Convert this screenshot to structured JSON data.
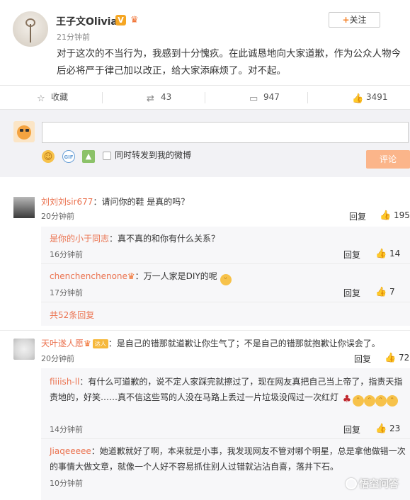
{
  "post": {
    "username": "王子文Olivia",
    "verified_badge": "V",
    "time": "21分钟前",
    "text": "对于这次的不当行为，我感到十分愧疚。在此诚恳地向大家道歉，作为公众人物今后必将严于律己加以改正，给大家添麻烦了。对不起。",
    "follow_label": "关注",
    "follow_plus": "+"
  },
  "actions": {
    "favorite": "收藏",
    "repost_count": "43",
    "comment_count": "947",
    "like_count": "3491"
  },
  "composer": {
    "input_value": "",
    "repost_label": "同时转发到我的微博",
    "submit_label": "评论",
    "gif_label": "GIF"
  },
  "comments": [
    {
      "name": "刘刘刘sir677",
      "text": "：请问你的鞋 是真的吗？",
      "time": "20分钟前",
      "reply": "回复",
      "likes": "195",
      "sub_replies": [
        {
          "name": "是你的小于同志",
          "text": "：真不真的和你有什么关系？",
          "time": "16分钟前",
          "reply": "回复",
          "likes": "14"
        },
        {
          "name": "chenchenchenone",
          "text": "：万一人家是DIY的呢",
          "time": "17分钟前",
          "reply": "回复",
          "likes": "7"
        }
      ],
      "more_replies": "共52条回复"
    },
    {
      "name": "天叶遂人愿",
      "badge": "达人",
      "text": "：是自己的错那就道歉让你生气了；不是自己的错那就抱歉让你误会了。",
      "time": "20分钟前",
      "reply": "回复",
      "likes": "72",
      "sub_replies": [
        {
          "name": "fiiiish-ll",
          "text": "：有什么可道歉的，说不定人家踩完就擦过了，现在网友真把自己当上帝了，指责天指责地的，好笑……真不信这些骂的人没在马路上丢过一片垃圾没闯过一次红灯",
          "time": "14分钟前",
          "reply": "回复",
          "likes": "23"
        },
        {
          "name": "Jiaqeeeee",
          "text": "：她道歉就好了啊，本来就是小事，我发现网友不管对哪个明星，总是拿他做错一次的事情大做文章，就像一个人好不容易抓住别人过错就沾沾自喜，落井下石。",
          "time": "10分钟前",
          "reply": "",
          "likes": ""
        }
      ]
    }
  ],
  "watermark": "悟空问答"
}
